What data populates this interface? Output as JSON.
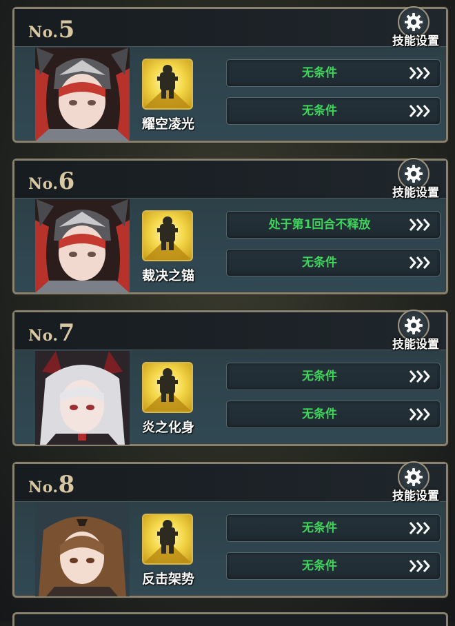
{
  "settings_label": "技能设置",
  "no_prefix": "No.",
  "colors": {
    "condition_text": "#3fd45a",
    "number_gold": "#d8c8a2",
    "frame": "#8a8270"
  },
  "cards": [
    {
      "number": "5",
      "skill_name": "耀空凌光",
      "portrait": "red-haired-armored-knight",
      "conditions": [
        "无条件",
        "无条件"
      ]
    },
    {
      "number": "6",
      "skill_name": "裁决之锚",
      "portrait": "red-haired-armored-knight",
      "conditions": [
        "处于第1回合不释放",
        "无条件"
      ]
    },
    {
      "number": "7",
      "skill_name": "炎之化身",
      "portrait": "white-haired-horned-girl",
      "conditions": [
        "无条件",
        "无条件"
      ]
    },
    {
      "number": "8",
      "skill_name": "反击架势",
      "portrait": "brown-haired-girl",
      "conditions": [
        "无条件",
        "无条件"
      ]
    }
  ]
}
